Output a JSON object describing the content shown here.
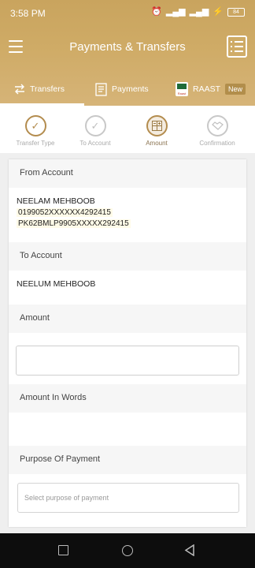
{
  "status_bar": {
    "time": "3:58 PM",
    "battery": "84"
  },
  "appbar": {
    "title": "Payments & Transfers"
  },
  "tabs": [
    {
      "label": "Transfers"
    },
    {
      "label": "Payments"
    },
    {
      "label": "RAAST",
      "badge": "New",
      "logo_text": "Raast"
    }
  ],
  "steps": [
    {
      "label": "Transfer Type",
      "state": "done"
    },
    {
      "label": "To Account",
      "state": "pending"
    },
    {
      "label": "Amount",
      "state": "active"
    },
    {
      "label": "Confirmation",
      "state": "pending"
    }
  ],
  "form": {
    "from_account": {
      "heading": "From Account",
      "name": "NEELAM MEHBOOB",
      "account_number": "0199052XXXXXX4292415",
      "iban": "PK62BMLP9905XXXXX292415"
    },
    "to_account": {
      "heading": "To Account",
      "name": "NEELUM MEHBOOB"
    },
    "amount": {
      "heading": "Amount",
      "value": ""
    },
    "amount_in_words": {
      "heading": "Amount In Words",
      "value": ""
    },
    "purpose": {
      "heading": "Purpose Of Payment",
      "placeholder": "Select purpose of payment"
    }
  },
  "colors": {
    "brand_gold": "#c9a45e",
    "active_step": "#b38c4e"
  }
}
